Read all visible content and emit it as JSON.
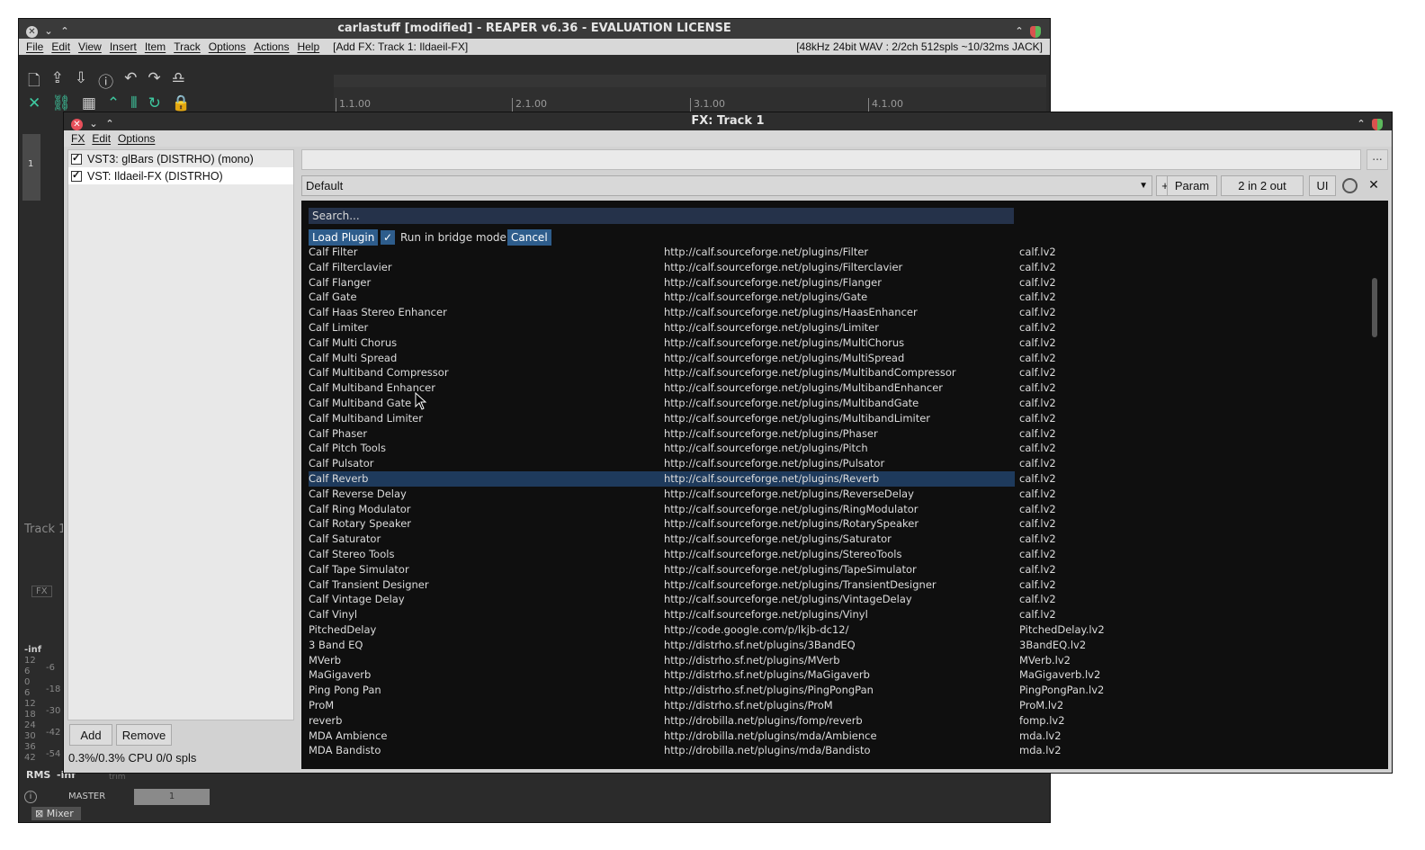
{
  "reaper": {
    "title": "carlastuff [modified] - REAPER v6.36 - EVALUATION LICENSE",
    "menu": [
      "File",
      "Edit",
      "View",
      "Insert",
      "Item",
      "Track",
      "Options",
      "Actions",
      "Help"
    ],
    "action_info": "[Add FX: Track 1: Ildaeil-FX]",
    "audio_status": "[48kHz 24bit WAV : 2/2ch 512spls ~10/32ms JACK]",
    "ruler_marks": [
      "1.1.00",
      "2.1.00",
      "3.1.00",
      "4.1.00"
    ],
    "track_number": "1",
    "track_label": "Track 1",
    "fx_label": "FX",
    "meter_labels": [
      "-inf",
      "12",
      "6",
      "0",
      "6",
      "12",
      "18",
      "24",
      "30",
      "36",
      "42",
      "-6",
      "-18",
      "-30",
      "-42",
      "-54"
    ],
    "rms_label": "RMS",
    "rms_value": "-inf",
    "trim_label": "trim",
    "master_label": "MASTER",
    "master_number": "1",
    "mixer_tab": "Mixer"
  },
  "fx_window": {
    "title": "FX: Track 1",
    "menu": [
      "FX",
      "Edit",
      "Options"
    ],
    "chain": [
      {
        "label": "VST3: glBars (DISTRHO) (mono)",
        "checked": true
      },
      {
        "label": "VST: Ildaeil-FX (DISTRHO)",
        "checked": true
      }
    ],
    "add_label": "Add",
    "remove_label": "Remove",
    "cpu_status": "0.3%/0.3% CPU 0/0 spls",
    "preset_value": "Default",
    "dots_label": "...",
    "plus_label": "+",
    "param_label": "Param",
    "io_label": "2 in 2 out",
    "ui_label": "UI",
    "close_label": "✕"
  },
  "browser": {
    "search_placeholder": "Search...",
    "load_label": "Load Plugin",
    "bridge_label": "Run in bridge mode",
    "bridge_checked": true,
    "cancel_label": "Cancel",
    "selected_index": 15,
    "plugins": [
      {
        "name": "Calf Filter",
        "uri": "http://calf.sourceforge.net/plugins/Filter",
        "bundle": "calf.lv2"
      },
      {
        "name": "Calf Filterclavier",
        "uri": "http://calf.sourceforge.net/plugins/Filterclavier",
        "bundle": "calf.lv2"
      },
      {
        "name": "Calf Flanger",
        "uri": "http://calf.sourceforge.net/plugins/Flanger",
        "bundle": "calf.lv2"
      },
      {
        "name": "Calf Gate",
        "uri": "http://calf.sourceforge.net/plugins/Gate",
        "bundle": "calf.lv2"
      },
      {
        "name": "Calf Haas Stereo Enhancer",
        "uri": "http://calf.sourceforge.net/plugins/HaasEnhancer",
        "bundle": "calf.lv2"
      },
      {
        "name": "Calf Limiter",
        "uri": "http://calf.sourceforge.net/plugins/Limiter",
        "bundle": "calf.lv2"
      },
      {
        "name": "Calf Multi Chorus",
        "uri": "http://calf.sourceforge.net/plugins/MultiChorus",
        "bundle": "calf.lv2"
      },
      {
        "name": "Calf Multi Spread",
        "uri": "http://calf.sourceforge.net/plugins/MultiSpread",
        "bundle": "calf.lv2"
      },
      {
        "name": "Calf Multiband Compressor",
        "uri": "http://calf.sourceforge.net/plugins/MultibandCompressor",
        "bundle": "calf.lv2"
      },
      {
        "name": "Calf Multiband Enhancer",
        "uri": "http://calf.sourceforge.net/plugins/MultibandEnhancer",
        "bundle": "calf.lv2"
      },
      {
        "name": "Calf Multiband Gate",
        "uri": "http://calf.sourceforge.net/plugins/MultibandGate",
        "bundle": "calf.lv2"
      },
      {
        "name": "Calf Multiband Limiter",
        "uri": "http://calf.sourceforge.net/plugins/MultibandLimiter",
        "bundle": "calf.lv2"
      },
      {
        "name": "Calf Phaser",
        "uri": "http://calf.sourceforge.net/plugins/Phaser",
        "bundle": "calf.lv2"
      },
      {
        "name": "Calf Pitch Tools",
        "uri": "http://calf.sourceforge.net/plugins/Pitch",
        "bundle": "calf.lv2"
      },
      {
        "name": "Calf Pulsator",
        "uri": "http://calf.sourceforge.net/plugins/Pulsator",
        "bundle": "calf.lv2"
      },
      {
        "name": "Calf Reverb",
        "uri": "http://calf.sourceforge.net/plugins/Reverb",
        "bundle": "calf.lv2"
      },
      {
        "name": "Calf Reverse Delay",
        "uri": "http://calf.sourceforge.net/plugins/ReverseDelay",
        "bundle": "calf.lv2"
      },
      {
        "name": "Calf Ring Modulator",
        "uri": "http://calf.sourceforge.net/plugins/RingModulator",
        "bundle": "calf.lv2"
      },
      {
        "name": "Calf Rotary Speaker",
        "uri": "http://calf.sourceforge.net/plugins/RotarySpeaker",
        "bundle": "calf.lv2"
      },
      {
        "name": "Calf Saturator",
        "uri": "http://calf.sourceforge.net/plugins/Saturator",
        "bundle": "calf.lv2"
      },
      {
        "name": "Calf Stereo Tools",
        "uri": "http://calf.sourceforge.net/plugins/StereoTools",
        "bundle": "calf.lv2"
      },
      {
        "name": "Calf Tape Simulator",
        "uri": "http://calf.sourceforge.net/plugins/TapeSimulator",
        "bundle": "calf.lv2"
      },
      {
        "name": "Calf Transient Designer",
        "uri": "http://calf.sourceforge.net/plugins/TransientDesigner",
        "bundle": "calf.lv2"
      },
      {
        "name": "Calf Vintage Delay",
        "uri": "http://calf.sourceforge.net/plugins/VintageDelay",
        "bundle": "calf.lv2"
      },
      {
        "name": "Calf Vinyl",
        "uri": "http://calf.sourceforge.net/plugins/Vinyl",
        "bundle": "calf.lv2"
      },
      {
        "name": "PitchedDelay",
        "uri": "http://code.google.com/p/lkjb-dc12/",
        "bundle": "PitchedDelay.lv2"
      },
      {
        "name": "3 Band EQ",
        "uri": "http://distrho.sf.net/plugins/3BandEQ",
        "bundle": "3BandEQ.lv2"
      },
      {
        "name": "MVerb",
        "uri": "http://distrho.sf.net/plugins/MVerb",
        "bundle": "MVerb.lv2"
      },
      {
        "name": "MaGigaverb",
        "uri": "http://distrho.sf.net/plugins/MaGigaverb",
        "bundle": "MaGigaverb.lv2"
      },
      {
        "name": "Ping Pong Pan",
        "uri": "http://distrho.sf.net/plugins/PingPongPan",
        "bundle": "PingPongPan.lv2"
      },
      {
        "name": "ProM",
        "uri": "http://distrho.sf.net/plugins/ProM",
        "bundle": "ProM.lv2"
      },
      {
        "name": "reverb",
        "uri": "http://drobilla.net/plugins/fomp/reverb",
        "bundle": "fomp.lv2"
      },
      {
        "name": "MDA Ambience",
        "uri": "http://drobilla.net/plugins/mda/Ambience",
        "bundle": "mda.lv2"
      },
      {
        "name": "MDA Bandisto",
        "uri": "http://drobilla.net/plugins/mda/Bandisto",
        "bundle": "mda.lv2"
      }
    ]
  },
  "colors": {
    "selection": "#1e3a5c",
    "button_blue": "#2e5d8c",
    "browser_bg": "#0f0f0f",
    "reaper_green": "#3ec9a0"
  }
}
